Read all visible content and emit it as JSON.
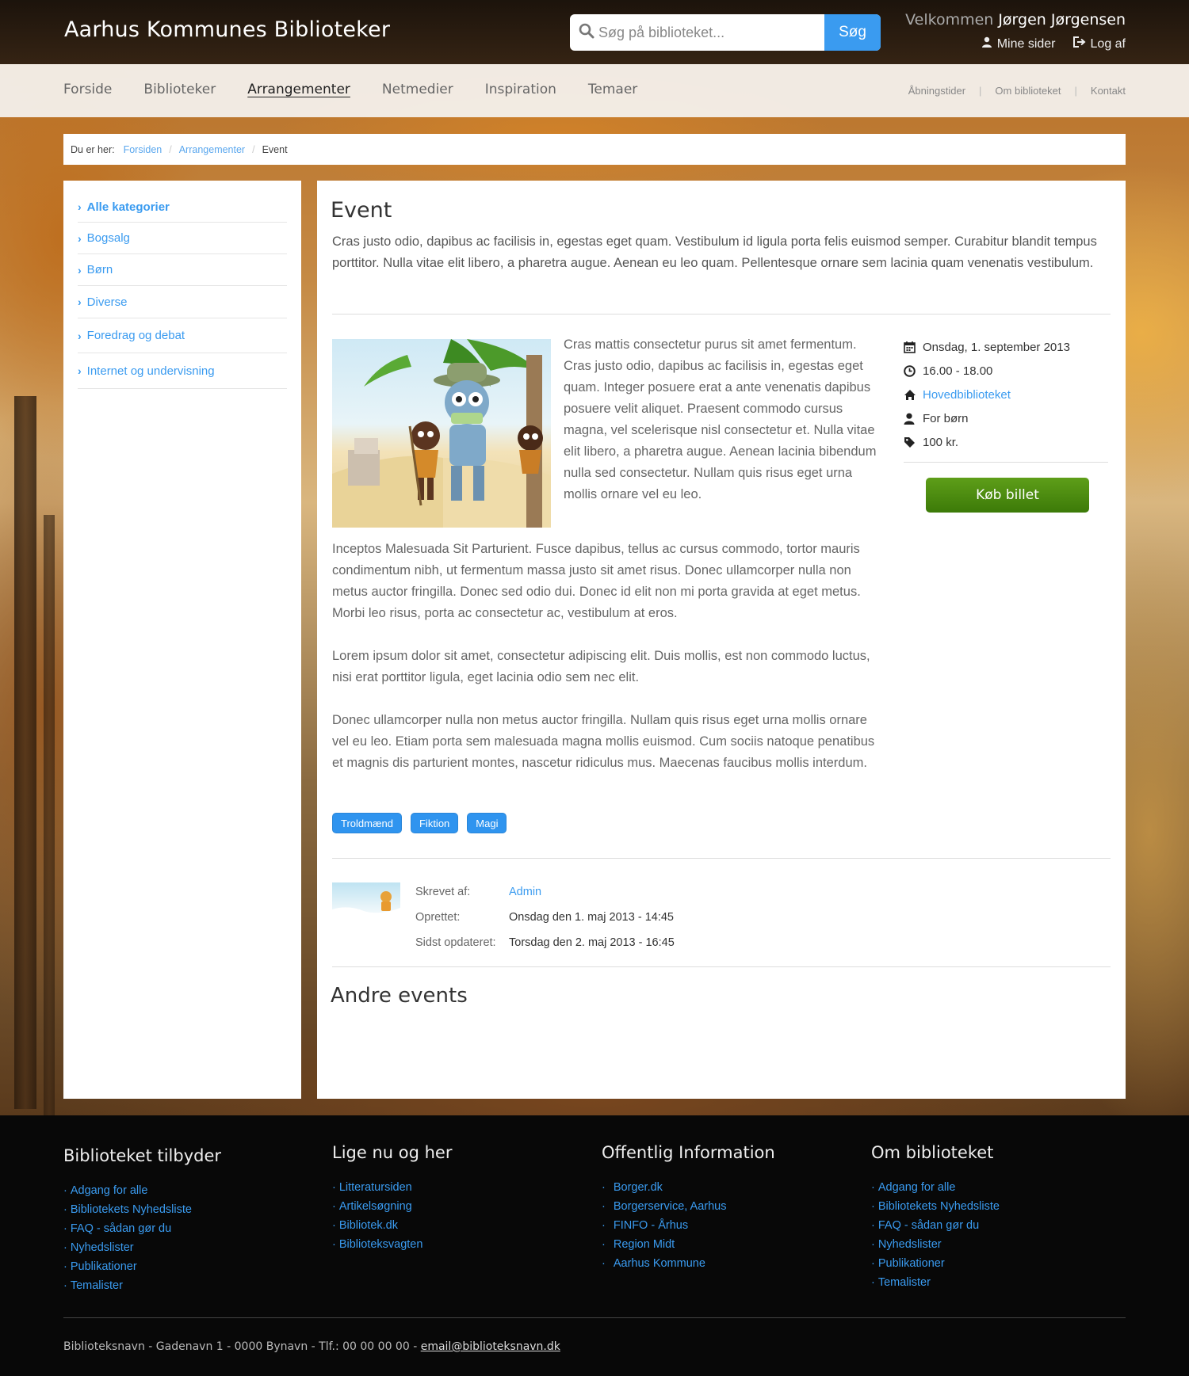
{
  "header": {
    "site_title": "Aarhus Kommunes Biblioteker",
    "search_placeholder": "Søg på biblioteket...",
    "search_button": "Søg",
    "welcome_label": "Velkommen",
    "user_name": "Jørgen Jørgensen",
    "my_pages": "Mine sider",
    "logout": "Log af"
  },
  "nav": {
    "items": [
      "Forside",
      "Biblioteker",
      "Arrangementer",
      "Netmedier",
      "Inspiration",
      "Temaer"
    ],
    "active": "Arrangementer",
    "secondary": [
      "Åbningstider",
      "Om biblioteket",
      "Kontakt"
    ]
  },
  "breadcrumb": {
    "label": "Du er her:",
    "items": [
      "Forsiden",
      "Arrangementer",
      "Event"
    ]
  },
  "sidebar": {
    "items": [
      "Alle kategorier",
      "Bogsalg",
      "Børn",
      "Diverse",
      "Foredrag og debat",
      "Internet og undervisning"
    ]
  },
  "event": {
    "title": "Event",
    "lead": "Cras justo odio, dapibus ac facilisis in, egestas eget quam. Vestibulum id ligula porta felis euismod semper. Curabitur blandit tempus porttitor. Nulla vitae elit libero, a pharetra augue. Aenean eu leo quam. Pellentesque ornare sem lacinia quam venenatis vestibulum.",
    "para1": "Cras mattis consectetur purus sit amet fermentum. Cras justo odio, dapibus ac facilisis in, egestas eget quam. Integer posuere erat a ante venenatis dapibus posuere velit aliquet. Praesent commodo cursus magna, vel scelerisque nisl consectetur et. Nulla vitae elit libero, a pharetra augue. Aenean lacinia bibendum nulla sed consectetur. Nullam quis risus eget urna mollis ornare vel eu leo.",
    "para2": "Inceptos Malesuada Sit Parturient. Fusce dapibus, tellus ac cursus commodo, tortor mauris condimentum nibh, ut fermentum massa justo sit amet risus. Donec ullamcorper nulla non metus auctor fringilla. Donec sed odio dui. Donec id elit non mi porta gravida at eget metus. Morbi leo risus, porta ac consectetur ac, vestibulum at eros.",
    "para3": "Lorem ipsum dolor sit amet, consectetur adipiscing elit. Duis mollis, est non commodo luctus, nisi erat porttitor ligula, eget lacinia odio sem nec elit.",
    "para4": "Donec ullamcorper nulla non metus auctor fringilla. Nullam quis risus eget urna mollis ornare vel eu leo. Etiam porta sem malesuada magna mollis euismod. Cum sociis natoque penatibus et magnis dis parturient montes, nascetur ridiculus mus. Maecenas faucibus mollis interdum.",
    "date": "Onsdag, 1. september 2013",
    "time": "16.00 - 18.00",
    "location": "Hovedbiblioteket",
    "audience": "For børn",
    "price": "100 kr.",
    "buy_button": "Køb billet",
    "tags": [
      "Troldmænd",
      "Fiktion",
      "Magi"
    ],
    "meta": {
      "author_label": "Skrevet af:",
      "author": "Admin",
      "created_label": "Oprettet:",
      "created": "Onsdag den 1. maj 2013 - 14:45",
      "updated_label": "Sidst opdateret:",
      "updated": "Torsdag den 2. maj 2013 - 16:45"
    },
    "other_title": "Andre events"
  },
  "footer": {
    "columns": [
      {
        "title": "Biblioteket tilbyder",
        "links": [
          "Adgang for alle",
          "Bibliotekets Nyhedsliste",
          "FAQ - sådan gør du",
          "Nyhedslister",
          "Publikationer",
          "Temalister"
        ]
      },
      {
        "title": "Lige nu og her",
        "links": [
          "Litteratursiden",
          "Artikelsøgning",
          "Bibliotek.dk",
          "Biblioteksvagten"
        ]
      },
      {
        "title": "Offentlig Information",
        "links": [
          "Borger.dk",
          "Borgerservice, Aarhus",
          "FINFO - Århus",
          "Region Midt",
          "Aarhus Kommune"
        ]
      },
      {
        "title": "Om biblioteket",
        "links": [
          "Adgang for alle",
          "Bibliotekets Nyhedsliste",
          "FAQ - sådan gør du",
          "Nyhedslister",
          "Publikationer",
          "Temalister"
        ]
      }
    ],
    "address": "Biblioteksnavn - Gadenavn 1 - 0000 Bynavn - Tlf.: 00 00 00 00 -",
    "email": "email@biblioteksnavn.dk"
  },
  "colors": {
    "accent": "#3a9bf0",
    "buy_button": "#4a8c10",
    "footer_bg": "#080808"
  }
}
